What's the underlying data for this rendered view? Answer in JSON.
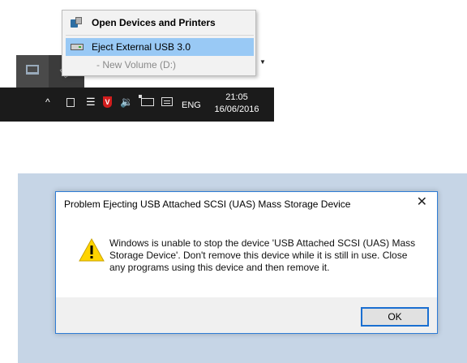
{
  "menu": {
    "open_devices": "Open Devices and Printers",
    "eject_item": "Eject External USB 3.0",
    "volume_item": "- New Volume (D:)"
  },
  "tray": {
    "language": "ENG",
    "time": "21:05",
    "date": "16/06/2016",
    "chevron": "^",
    "antivirus_letter": "V"
  },
  "dialog": {
    "title": "Problem Ejecting USB Attached SCSI (UAS) Mass Storage Device",
    "message": "Windows is unable to stop the device 'USB Attached SCSI (UAS) Mass Storage Device'. Don't remove this device while it is still in use. Close any programs using this device and then remove it.",
    "ok_label": "OK",
    "close_glyph": "✕"
  },
  "colors": {
    "taskbar": "#1b1b1b",
    "menu_highlight": "#99c9f5",
    "dialog_border": "#2e7cd6",
    "desktop": "#c6d5e6",
    "warning": "#ffd400"
  },
  "icons": [
    "devices-printers-icon",
    "usb-drive-icon",
    "laptop-icon",
    "wifi-icon",
    "antivirus-shield-icon",
    "volume-icon",
    "usb-tray-icon",
    "action-center-icon",
    "warning-icon"
  ]
}
